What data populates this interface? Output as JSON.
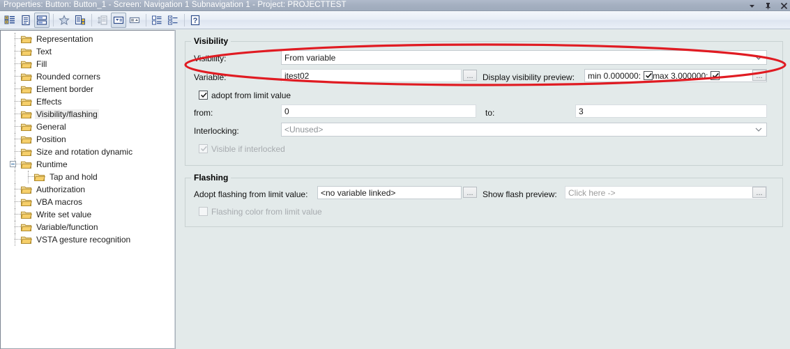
{
  "window": {
    "title": "Properties: Button: Button_1 - Screen: Navigation 1 Subnavigation 1 - Project: PROJECTTEST",
    "controls": [
      {
        "name": "dropdown-menu-button",
        "glyph": "▼"
      },
      {
        "name": "auto-hide-pin-button",
        "glyph": "⚲"
      },
      {
        "name": "close-button",
        "glyph": "✕"
      }
    ]
  },
  "toolbar": {
    "buttons": [
      {
        "name": "categorized-view-button",
        "title": "Categorized",
        "state": "normal"
      },
      {
        "name": "property-pages-button",
        "title": "Property Pages",
        "state": "normal"
      },
      {
        "name": "split-view-button",
        "title": "Split View",
        "state": "pressed"
      },
      {
        "name": "favorites-button",
        "title": "Favorites",
        "state": "normal"
      },
      {
        "name": "all-properties-button",
        "title": "All Properties",
        "state": "normal"
      },
      {
        "name": "sort-button",
        "title": "Sort",
        "state": "disabled"
      },
      {
        "name": "expand-down-button",
        "title": "Expand",
        "state": "pressed"
      },
      {
        "name": "collapse-up-button",
        "title": "Collapse",
        "state": "normal"
      },
      {
        "name": "group-list-button",
        "title": "Group",
        "state": "normal"
      },
      {
        "name": "expand-all-button",
        "title": "Expand All",
        "state": "normal"
      },
      {
        "name": "help-button",
        "title": "Help",
        "state": "normal"
      }
    ]
  },
  "tree": {
    "items": [
      {
        "label": "Representation",
        "level": 1,
        "expander": false,
        "selected": false
      },
      {
        "label": "Text",
        "level": 1,
        "expander": false,
        "selected": false
      },
      {
        "label": "Fill",
        "level": 1,
        "expander": false,
        "selected": false
      },
      {
        "label": "Rounded corners",
        "level": 1,
        "expander": false,
        "selected": false
      },
      {
        "label": "Element border",
        "level": 1,
        "expander": false,
        "selected": false
      },
      {
        "label": "Effects",
        "level": 1,
        "expander": false,
        "selected": false
      },
      {
        "label": "Visibility/flashing",
        "level": 1,
        "expander": false,
        "selected": true
      },
      {
        "label": "General",
        "level": 1,
        "expander": false,
        "selected": false
      },
      {
        "label": "Position",
        "level": 1,
        "expander": false,
        "selected": false
      },
      {
        "label": "Size and rotation dynamic",
        "level": 1,
        "expander": false,
        "selected": false
      },
      {
        "label": "Runtime",
        "level": 1,
        "expander": true,
        "selected": false
      },
      {
        "label": "Tap and hold",
        "level": 2,
        "expander": false,
        "selected": false
      },
      {
        "label": "Authorization",
        "level": 1,
        "expander": false,
        "selected": false
      },
      {
        "label": "VBA macros",
        "level": 1,
        "expander": false,
        "selected": false
      },
      {
        "label": "Write set value",
        "level": 1,
        "expander": false,
        "selected": false
      },
      {
        "label": "Variable/function",
        "level": 1,
        "expander": false,
        "selected": false
      },
      {
        "label": "VSTA gesture recognition",
        "level": 1,
        "expander": false,
        "selected": false
      }
    ]
  },
  "visibility": {
    "group_title": "Visibility",
    "visibility_label": "Visibility:",
    "visibility_value": "From variable",
    "variable_label": "Variable:",
    "variable_value": "itest02",
    "variable_browse_label": "...",
    "preview_label": "Display visibility preview:",
    "preview_min_text": "min 0.000000:",
    "preview_max_text": "max 3.000000:",
    "preview_min_checked": true,
    "preview_max_checked": true,
    "preview_browse_label": "...",
    "adopt_label": "adopt from limit value",
    "adopt_checked": true,
    "from_label": "from:",
    "from_value": "0",
    "to_label": "to:",
    "to_value": "3",
    "interlocking_label": "Interlocking:",
    "interlocking_value": "<Unused>",
    "visible_if_interlocked_label": "Visible if interlocked",
    "visible_if_interlocked_checked": true,
    "visible_if_interlocked_disabled": true
  },
  "flashing": {
    "group_title": "Flashing",
    "adopt_label": "Adopt flashing from limit value:",
    "adopt_value": "<no variable linked>",
    "adopt_browse_label": "...",
    "show_preview_label": "Show flash preview:",
    "show_preview_value": "Click here ->",
    "show_preview_browse_label": "...",
    "color_from_limit_label": "Flashing color from limit value",
    "color_from_limit_checked": false
  },
  "colors": {
    "titlebar": "#a4afc0",
    "panel_bg": "#e3eaea",
    "annotation_red": "#e01b22",
    "folder_yellow": "#f6d479",
    "selection_gray": "#eeeeee"
  }
}
